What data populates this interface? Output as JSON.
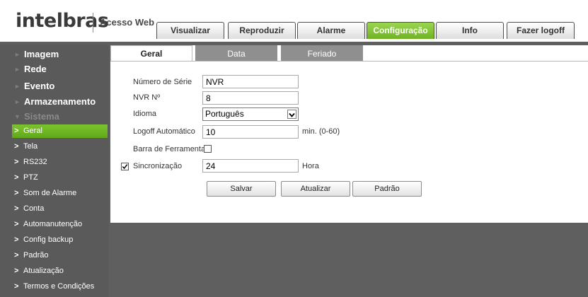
{
  "header": {
    "logo_text": "intelbras",
    "subtitle": "Acesso Web",
    "tabs": [
      {
        "label": "Visualizar"
      },
      {
        "label": "Reproduzir"
      },
      {
        "label": "Alarme"
      },
      {
        "label": "Configuração",
        "active": true
      },
      {
        "label": "Info"
      },
      {
        "label": "Fazer logoff"
      }
    ]
  },
  "sidebar": {
    "categories": [
      {
        "label": "Imagem"
      },
      {
        "label": "Rede"
      },
      {
        "label": "Evento"
      },
      {
        "label": "Armazenamento"
      },
      {
        "label": "Sistema",
        "expanded": true
      }
    ],
    "items": [
      {
        "label": "Geral",
        "active": true
      },
      {
        "label": "Tela"
      },
      {
        "label": "RS232"
      },
      {
        "label": "PTZ"
      },
      {
        "label": "Som de Alarme"
      },
      {
        "label": "Conta"
      },
      {
        "label": "Automanutenção"
      },
      {
        "label": "Config backup"
      },
      {
        "label": "Padrão"
      },
      {
        "label": "Atualização"
      },
      {
        "label": "Termos e Condições"
      }
    ]
  },
  "content": {
    "tabs": [
      {
        "label": "Geral",
        "active": true
      },
      {
        "label": "Data"
      },
      {
        "label": "Feriado"
      }
    ],
    "form": {
      "serial_label": "Número de Série",
      "serial_value": "NVR",
      "nvr_no_label": "NVR Nº",
      "nvr_no_value": "8",
      "language_label": "Idioma",
      "language_value": "Português",
      "logoff_label": "Logoff Automático",
      "logoff_value": "10",
      "logoff_unit": "min. (0-60)",
      "toolbar_label": "Barra de Ferramentas",
      "toolbar_checked": false,
      "sync_label": "Sincronização",
      "sync_checked": true,
      "sync_value": "24",
      "sync_unit": "Hora"
    },
    "buttons": {
      "save": "Salvar",
      "refresh": "Atualizar",
      "default": "Padrão"
    }
  },
  "colors": {
    "accent_green": "#6fb324",
    "background": "#5f5f5f",
    "tab_inactive": "#8f8f8f"
  }
}
